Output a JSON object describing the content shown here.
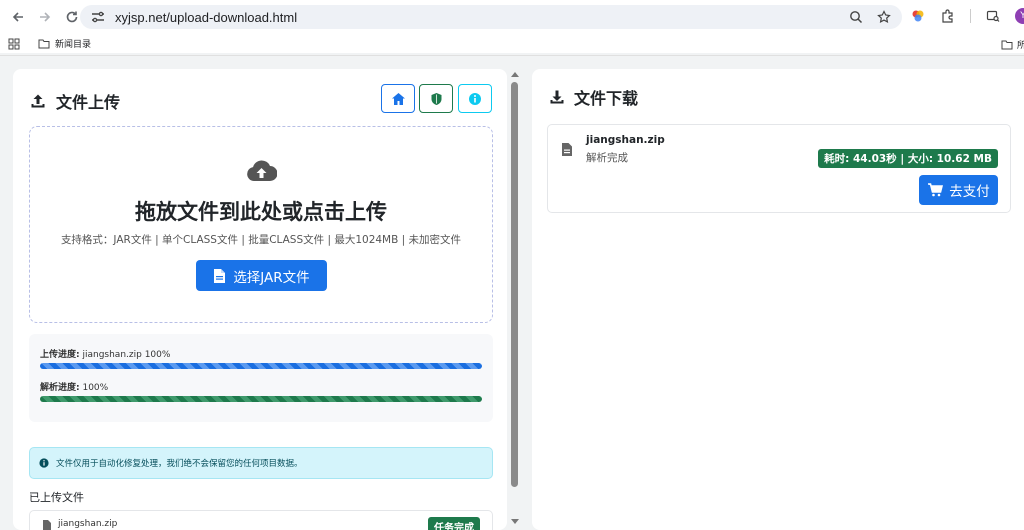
{
  "browser": {
    "url": "xyjsp.net/upload-download.html",
    "bookmark_folder": "新闻目录",
    "bookmark_right": "所",
    "avatar_letter": "Y"
  },
  "upload": {
    "title": "文件上传",
    "drop_title": "拖放文件到此处或点击上传",
    "drop_formats": "支持格式：JAR文件 | 单个CLASS文件 | 批量CLASS文件 | 最大1024MB | 未加密文件",
    "choose_button": "选择JAR文件",
    "upload_progress_label": "上传进度:",
    "upload_progress_text": "jiangshan.zip 100%",
    "upload_progress": 1.0,
    "parse_progress_label": "解析进度:",
    "parse_progress_text": "100%",
    "parse_progress": 1.0,
    "notice": "文件仅用于自动化修复处理，我们绝不会保留您的任何项目数据。",
    "uploaded_title": "已上传文件",
    "uploaded_file": "jiangshan.zip",
    "uploaded_status": "任务完成"
  },
  "download": {
    "title": "文件下载",
    "file_name": "jiangshan.zip",
    "file_status": "解析完成",
    "time_size": "耗时: 44.03秒 | 大小: 10.62 MB",
    "pay_button": "去支付"
  },
  "colors": {
    "primary": "#1a73e8",
    "success": "#1e7a4c",
    "info": "#0dcaf0",
    "green_border": "#1e7a4c"
  }
}
